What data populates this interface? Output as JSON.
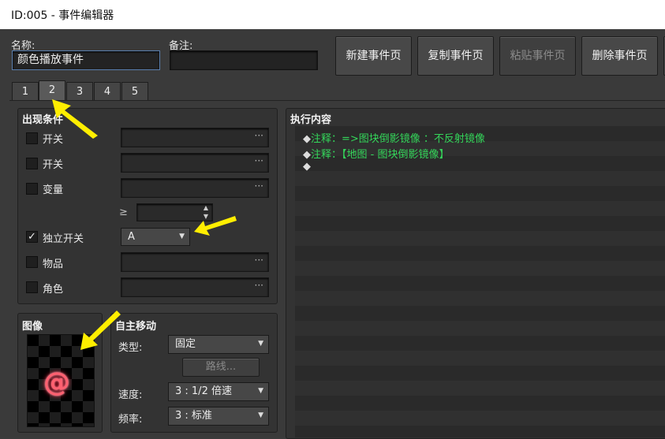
{
  "window": {
    "title": "ID:005 - 事件编辑器"
  },
  "header": {
    "name_label": "名称:",
    "name_value": "颜色播放事件",
    "note_label": "备注:",
    "note_value": "",
    "buttons": {
      "new_page": "新建事件页",
      "copy_page": "复制事件页",
      "paste_page": "粘贴事件页",
      "delete_page": "删除事件页"
    }
  },
  "tabs": [
    "1",
    "2",
    "3",
    "4",
    "5"
  ],
  "active_tab": "2",
  "conditions": {
    "title": "出现条件",
    "switch1_label": "开关",
    "switch2_label": "开关",
    "variable_label": "变量",
    "ge_symbol": "≥",
    "self_switch_label": "独立开关",
    "self_switch_value": "A",
    "item_label": "物品",
    "actor_label": "角色",
    "dots": "···"
  },
  "image": {
    "title": "图像",
    "glyph": "@"
  },
  "autonomous": {
    "title": "自主移动",
    "type_label": "类型:",
    "type_value": "固定",
    "route_button": "路线...",
    "speed_label": "速度:",
    "speed_value": "3 : 1/2 倍速",
    "freq_label": "频率:",
    "freq_value": "3 : 标准"
  },
  "contents": {
    "title": "执行内容",
    "lines": [
      "注释：=>图块倒影镜像 ：不反射镜像",
      "注释：【地图 - 图块倒影镜像】",
      ""
    ],
    "bullet": "◆"
  },
  "colors": {
    "accent_green": "#34d65a",
    "annotation_arrow": "#ffee00"
  }
}
